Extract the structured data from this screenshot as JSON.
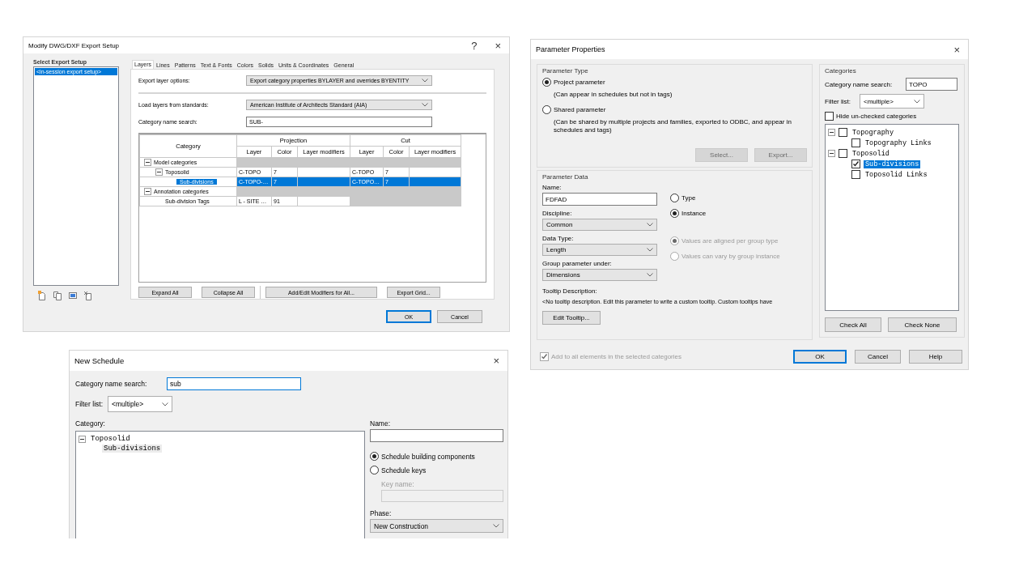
{
  "export_setup_dialog": {
    "title": "Modify DWG/DXF Export Setup",
    "help_button": "?",
    "close_button": "×",
    "setups_label": "Select Export Setup",
    "setups": [
      {
        "label": "<in-session export setup>",
        "selected": true
      }
    ],
    "tabs": [
      {
        "label": "Layers",
        "selected": true
      },
      {
        "label": "Lines",
        "selected": false
      },
      {
        "label": "Patterns",
        "selected": false
      },
      {
        "label": "Text & Fonts",
        "selected": false
      },
      {
        "label": "Colors",
        "selected": false
      },
      {
        "label": "Solids",
        "selected": false
      },
      {
        "label": "Units & Coordinates",
        "selected": false
      },
      {
        "label": "General",
        "selected": false
      }
    ],
    "export_layer_options": {
      "label": "Export layer options:",
      "value": "Export category properties BYLAYER and overrides BYENTITY"
    },
    "load_layers": {
      "label": "Load layers from standards:",
      "value": "American Institute of Architects Standard (AIA)"
    },
    "category_search": {
      "label": "Category name search:",
      "value": "SUB-"
    },
    "table": {
      "category_header": "Category",
      "groups": [
        "Projection",
        "Cut"
      ],
      "columns": [
        "Layer",
        "Color",
        "Layer modifiers",
        "Layer",
        "Color",
        "Layer modifiers"
      ],
      "rows": [
        {
          "kind": "group",
          "category": "Model categories",
          "expanded": true,
          "selected": false,
          "children": [
            {
              "kind": "category",
              "category": "Toposolid",
              "expanded": true,
              "selected": false,
              "projection": {
                "layer": "C-TOPO",
                "color_number": "7"
              },
              "cut": {
                "layer": "C-TOPO",
                "color_number": "7"
              },
              "children": [
                {
                  "kind": "category",
                  "category": "Sub-divisions",
                  "selected": true,
                  "projection": {
                    "layer": "C-TOPO-…",
                    "color_number": "7"
                  },
                  "cut": {
                    "layer": "C-TOPO…",
                    "color_number": "7"
                  }
                }
              ]
            }
          ]
        },
        {
          "kind": "group",
          "category": "Annotation categories",
          "expanded": true,
          "selected": false,
          "children": [
            {
              "kind": "category",
              "category": "Sub-division Tags",
              "selected": false,
              "projection": {
                "layer": "L - SITE …",
                "color_number": "91"
              }
            }
          ]
        }
      ]
    },
    "grid_buttons": [
      "Expand All",
      "Collapse All",
      "Add/Edit Modifiers for All...",
      "Export Grid..."
    ],
    "buttons": [
      {
        "label": "OK",
        "default": true
      },
      {
        "label": "Cancel",
        "default": false
      }
    ]
  },
  "parameter_properties_dialog": {
    "title": "Parameter Properties",
    "close_button": "×",
    "parameter_type": {
      "title": "Parameter Type",
      "options": [
        {
          "label": "Project parameter",
          "note": "(Can appear in schedules but not in tags)",
          "selected": true
        },
        {
          "label": "Shared parameter",
          "note": "(Can be shared by multiple projects and families, exported to ODBC, and appear in schedules and tags)",
          "selected": false
        }
      ],
      "buttons": [
        {
          "label": "Select...",
          "disabled": true
        },
        {
          "label": "Export...",
          "disabled": true
        }
      ]
    },
    "parameter_data": {
      "title": "Parameter Data",
      "name": {
        "label": "Name:",
        "value": "FDFAD"
      },
      "kind_options": [
        {
          "label": "Type",
          "selected": false
        },
        {
          "label": "Instance",
          "selected": true
        }
      ],
      "discipline": {
        "label": "Discipline:",
        "value": "Common"
      },
      "data_type": {
        "label": "Data Type:",
        "value": "Length"
      },
      "group_under": {
        "label": "Group parameter under:",
        "value": "Dimensions"
      },
      "group_options": [
        {
          "label": "Values are aligned per group type",
          "selected": true,
          "disabled": true
        },
        {
          "label": "Values can vary by group instance",
          "selected": false,
          "disabled": true
        }
      ],
      "tooltip_label": "Tooltip Description:",
      "tooltip": "<No tooltip description. Edit this parameter to write a custom tooltip. Custom tooltips have",
      "edit_tooltip_button": "Edit Tooltip..."
    },
    "add_to_all": {
      "label": "Add to all elements in the selected categories",
      "checked": true,
      "disabled": true
    },
    "categories": {
      "title": "Categories",
      "search": {
        "label": "Category name search:",
        "value": "TOPO"
      },
      "filter": {
        "label": "Filter list:",
        "value": "<multiple>"
      },
      "hide_unchecked": {
        "label": "Hide un-checked categories",
        "checked": false
      },
      "tree": [
        {
          "label": "Topography",
          "checked": false,
          "selected": false,
          "expanded": true,
          "children": [
            {
              "label": "Topography Links",
              "checked": false,
              "selected": false
            }
          ]
        },
        {
          "label": "Toposolid",
          "checked": false,
          "selected": false,
          "expanded": true,
          "children": [
            {
              "label": "Sub-divisions",
              "checked": true,
              "selected": true
            },
            {
              "label": "Toposolid Links",
              "checked": false,
              "selected": false
            }
          ]
        }
      ],
      "buttons": [
        "Check All",
        "Check None"
      ]
    },
    "buttons": [
      {
        "label": "OK",
        "default": true
      },
      {
        "label": "Cancel",
        "default": false
      },
      {
        "label": "Help",
        "default": false
      }
    ]
  },
  "new_schedule_dialog": {
    "title": "New Schedule",
    "close_button": "×",
    "search": {
      "label": "Category name search:",
      "value": "sub",
      "focused": true
    },
    "filter": {
      "label": "Filter list:",
      "value": "<multiple>"
    },
    "category_label": "Category:",
    "tree": [
      {
        "label": "Toposolid",
        "expanded": true,
        "selected": false,
        "children": [
          {
            "label": "Sub-divisions",
            "selected": true
          }
        ]
      }
    ],
    "name": {
      "label": "Name:"
    },
    "schedule_types": [
      {
        "label": "Schedule building components",
        "selected": true
      },
      {
        "label": "Schedule keys",
        "selected": false
      }
    ],
    "key_name": {
      "label": "Key name:",
      "disabled": true
    },
    "phase": {
      "label": "Phase:",
      "value": "New Construction"
    }
  }
}
